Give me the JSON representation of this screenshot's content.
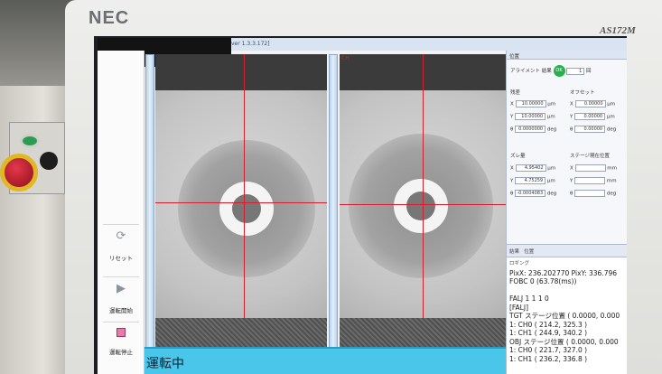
{
  "monitor": {
    "brand": "NEC",
    "model": "AS172M"
  },
  "app": {
    "title": "ver 1.3.3.172]"
  },
  "toolbar": {
    "reset": {
      "label": "リセット",
      "icon": "refresh-icon"
    },
    "start": {
      "label": "運転開始",
      "icon": "play-icon"
    },
    "stop": {
      "label": "運転停止",
      "icon": "stop-icon"
    }
  },
  "camera": {
    "right_label": "CH"
  },
  "panel": {
    "header": "位置",
    "align_result_label": "アライメント 結果",
    "align_status": "OK",
    "align_count": "1",
    "align_count_unit": "回",
    "pitch_label": "残差",
    "offset_label": "オフセット",
    "pitch": [
      {
        "axis": "X",
        "value": "10.00000",
        "unit": "μm"
      },
      {
        "axis": "Y",
        "value": "10.00000",
        "unit": "μm"
      },
      {
        "axis": "θ",
        "value": "0.0000000",
        "unit": "deg"
      }
    ],
    "offset": [
      {
        "axis": "X",
        "value": "0.00000",
        "unit": "μm"
      },
      {
        "axis": "Y",
        "value": "0.00000",
        "unit": "μm"
      },
      {
        "axis": "θ",
        "value": "0.00000",
        "unit": "deg"
      }
    ],
    "shift_label": "ズレ量",
    "stage_label": "ステージ現在位置",
    "shift": [
      {
        "axis": "X",
        "value": "4.95402",
        "unit": "μm"
      },
      {
        "axis": "Y",
        "value": "4.75259",
        "unit": "μm"
      },
      {
        "axis": "θ",
        "value": "-0.0004083",
        "unit": "deg"
      }
    ],
    "stage": [
      {
        "axis": "X",
        "value": "",
        "unit": "mm"
      },
      {
        "axis": "Y",
        "value": "",
        "unit": "mm"
      },
      {
        "axis": "θ",
        "value": "",
        "unit": "deg"
      }
    ],
    "tabs": [
      "結果",
      "位置"
    ],
    "log_header": "ロギング",
    "log": [
      "PixX: 236.202770 PixY: 336.796",
      "FOBC 0 (63.78(ms))",
      "",
      "FALJ 1 1 1 0",
      "[FALJ]",
      "TGT ステージ位置 ( 0.0000, 0.000",
      "1: CH0 ( 214.2, 325.3 )",
      "1: CH1 ( 244.9, 340.2 )",
      "OBJ ステージ位置 ( 0.0000, 0.000",
      "1: CH0 ( 221.7, 327.0 )",
      "1: CH1 ( 236.2, 336.8 )"
    ]
  },
  "status": {
    "text": "運転中"
  },
  "colors": {
    "status_bg": "#49c6ea",
    "crosshair": "#d02030",
    "ok": "#26b04e"
  }
}
